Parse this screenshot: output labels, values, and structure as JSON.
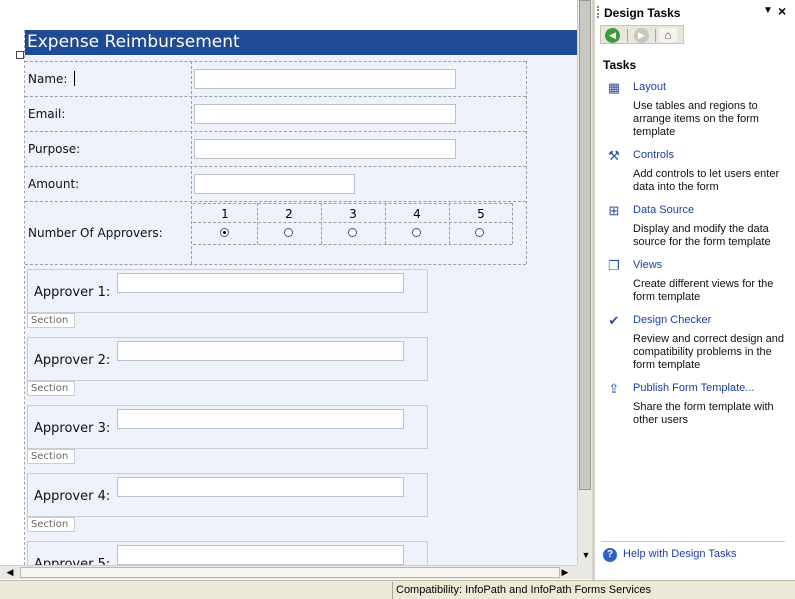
{
  "form": {
    "title": "Expense Reimbursement",
    "fields": [
      {
        "label": "Name:",
        "value": ""
      },
      {
        "label": "Email:",
        "value": ""
      },
      {
        "label": "Purpose:",
        "value": ""
      },
      {
        "label": "Amount:",
        "value": ""
      }
    ],
    "approvers_label": "Number Of Approvers:",
    "approver_options": [
      "1",
      "2",
      "3",
      "4",
      "5"
    ],
    "approver_selected": "1",
    "sections": [
      {
        "label": "Approver 1:",
        "tag": "Section"
      },
      {
        "label": "Approver 2:",
        "tag": "Section"
      },
      {
        "label": "Approver 3:",
        "tag": "Section"
      },
      {
        "label": "Approver 4:",
        "tag": "Section"
      },
      {
        "label": "Approver 5:",
        "tag": ""
      }
    ]
  },
  "task_pane": {
    "title": "Design Tasks",
    "section_title": "Tasks",
    "items": [
      {
        "link": "Layout",
        "desc": "Use tables and regions to arrange items on the form template",
        "icon": "layout-icon"
      },
      {
        "link": "Controls",
        "desc": "Add controls to let users enter data into the form",
        "icon": "controls-icon"
      },
      {
        "link": "Data Source",
        "desc": "Display and modify the data source for the form template",
        "icon": "data-source-icon"
      },
      {
        "link": "Views",
        "desc": "Create different views for the form template",
        "icon": "views-icon"
      },
      {
        "link": "Design Checker",
        "desc": "Review and correct design and compatibility problems in the form template",
        "icon": "design-checker-icon"
      },
      {
        "link": "Publish Form Template...",
        "desc": "Share the form template with other users",
        "icon": "publish-icon"
      }
    ],
    "help_link": "Help with Design Tasks"
  },
  "status": {
    "compatibility": "Compatibility: InfoPath and InfoPath Forms Services"
  }
}
